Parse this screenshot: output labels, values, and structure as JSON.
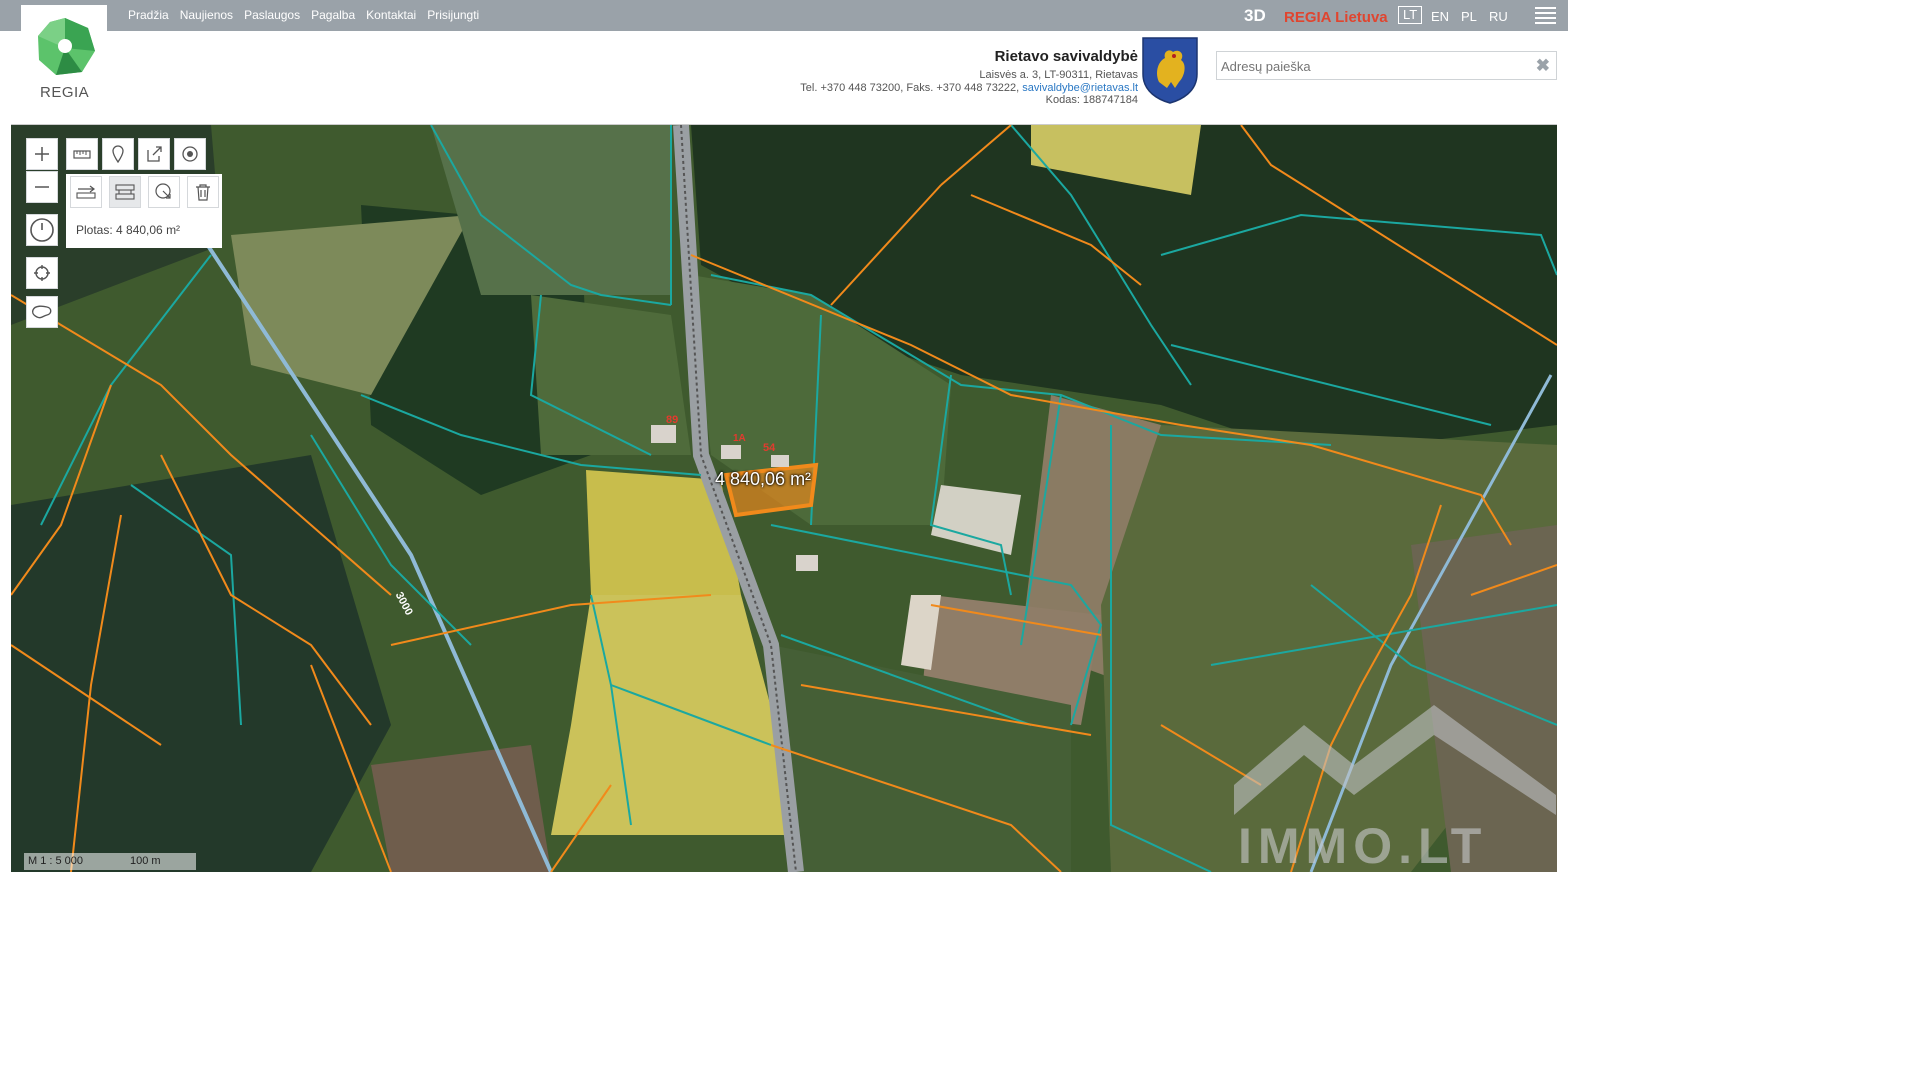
{
  "nav": {
    "items": [
      "Pradžia",
      "Naujienos",
      "Paslaugos",
      "Pagalba",
      "Kontaktai",
      "Prisijungti"
    ],
    "btn_3d": "3D",
    "regia_lietuva": "REGIA Lietuva",
    "languages": [
      "LT",
      "EN",
      "PL",
      "RU"
    ],
    "active_language": "LT"
  },
  "logo": {
    "text": "REGIA"
  },
  "municipality": {
    "title": "Rietavo savivaldybė",
    "address": "Laisvės a. 3, LT-90311, Rietavas",
    "phones": "Tel. +370 448 73200, Faks. +370 448 73222, ",
    "email": "savivaldybe@rietavas.lt",
    "code": "Kodas: 188747184"
  },
  "search": {
    "placeholder": "Adresų paieška",
    "clear_label": "✖"
  },
  "map": {
    "measurement_label": "4 840,06 m²",
    "parcel_numbers": [
      "89",
      "54",
      "1A"
    ],
    "road_label": "3000",
    "area_result": "Plotas: 4 840,06 m²",
    "scale_text": "M 1 : 5 000",
    "scale_bar": "100 m",
    "watermark": "IMMO.LT"
  },
  "colors": {
    "topbar": "#9aa2a9",
    "accent_red": "#e0452f",
    "parcel_orange": "#f18a1b",
    "parcel_teal": "#1ba8a0"
  }
}
